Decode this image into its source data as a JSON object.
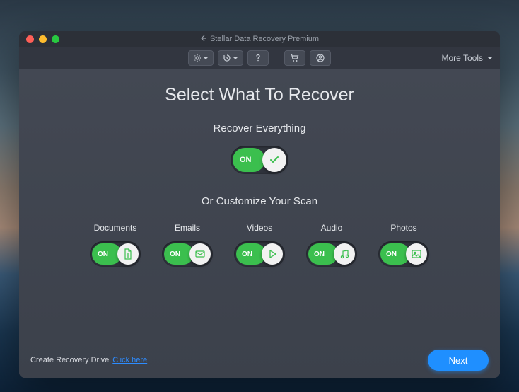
{
  "window": {
    "title": "Stellar Data Recovery Premium"
  },
  "toolbar": {
    "more_tools": "More Tools"
  },
  "main": {
    "heading": "Select What To Recover",
    "recover_all_label": "Recover Everything",
    "customize_label": "Or Customize Your Scan",
    "on": "ON"
  },
  "categories": [
    {
      "label": "Documents"
    },
    {
      "label": "Emails"
    },
    {
      "label": "Videos"
    },
    {
      "label": "Audio"
    },
    {
      "label": "Photos"
    }
  ],
  "footer": {
    "create_drive": "Create Recovery Drive",
    "click_here": "Click here",
    "next": "Next"
  }
}
